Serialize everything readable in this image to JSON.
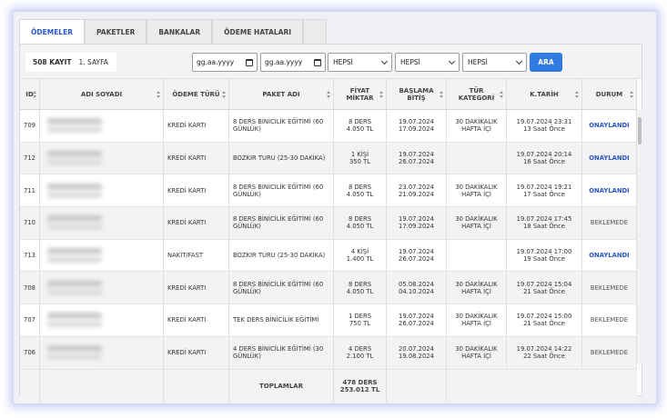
{
  "tabs": [
    {
      "label": "ÖDEMELER",
      "active": true
    },
    {
      "label": "PAKETLER"
    },
    {
      "label": "BANKALAR"
    },
    {
      "label": "ÖDEME HATALARI"
    }
  ],
  "toolbar": {
    "count": "508 KAYIT",
    "page": "1. SAYFA",
    "date1": "gg.aa.yyyy",
    "date2": "gg.aa.yyyy",
    "select1": "HEPSİ",
    "select2": "HEPSİ",
    "select3": "HEPSİ",
    "search_button": "ARA"
  },
  "columns": {
    "id": "ID",
    "name": "ADI SOYADI",
    "type": "ÖDEME TÜRÜ",
    "package": "PAKET ADI",
    "fee1": "FİYAT",
    "fee2": "MİKTAR",
    "date1": "BAŞLAMA",
    "date2": "BİTİŞ",
    "cat1": "TÜR",
    "cat2": "KATEGORİ",
    "ktarih": "K.TARİH",
    "status": "DURUM"
  },
  "rows": [
    {
      "id": "709",
      "type": "KREDİ KARTI",
      "package": "8 DERS BİNİCİLİK EĞİTİMİ (60 GÜNLÜK)",
      "qty": "8 DERS",
      "price": "4.050 TL",
      "start": "19.07.2024",
      "end": "17.09.2024",
      "cat1": "30 DAKİKALIK",
      "cat2": "HAFTA İÇİ",
      "kdate": "19.07.2024 23:31",
      "kago": "13 Saat Önce",
      "status": "ONAYLANDI",
      "ok": true
    },
    {
      "id": "712",
      "type": "KREDİ KARTI",
      "package": "BOZKIR TURU (25-30 DAKİKA)",
      "qty": "1 KİŞİ",
      "price": "350 TL",
      "start": "19.07.2024",
      "end": "26.07.2024",
      "cat1": "",
      "cat2": "",
      "kdate": "19.07.2024 20:14",
      "kago": "16 Saat Önce",
      "status": "ONAYLANDI",
      "ok": true
    },
    {
      "id": "711",
      "type": "KREDİ KARTI",
      "package": "8 DERS BİNİCİLİK EĞİTİMİ (60 GÜNLÜK)",
      "qty": "8 DERS",
      "price": "4.050 TL",
      "start": "23.07.2024",
      "end": "21.09.2024",
      "cat1": "30 DAKİKALIK",
      "cat2": "HAFTA İÇİ",
      "kdate": "19.07.2024 19:21",
      "kago": "17 Saat Önce",
      "status": "ONAYLANDI",
      "ok": true
    },
    {
      "id": "710",
      "type": "KREDİ KARTI",
      "package": "8 DERS BİNİCİLİK EĞİTİMİ (60 GÜNLÜK)",
      "qty": "8 DERS",
      "price": "4.050 TL",
      "start": "19.07.2024",
      "end": "17.09.2024",
      "cat1": "30 DAKİKALIK",
      "cat2": "HAFTA İÇİ",
      "kdate": "19.07.2024 17:45",
      "kago": "18 Saat Önce",
      "status": "BEKLEMEDE",
      "ok": false
    },
    {
      "id": "713",
      "type": "NAKİT/FAST",
      "package": "BOZKIR TURU (25-30 DAKİKA)",
      "qty": "4 KİŞİ",
      "price": "1.400 TL",
      "start": "19.07.2024",
      "end": "26.07.2024",
      "cat1": "",
      "cat2": "",
      "kdate": "19.07.2024 17:00",
      "kago": "19 Saat Önce",
      "status": "ONAYLANDI",
      "ok": true
    },
    {
      "id": "708",
      "type": "KREDİ KARTI",
      "package": "8 DERS BİNİCİLİK EĞİTİMİ (60 GÜNLÜK)",
      "qty": "8 DERS",
      "price": "4.050 TL",
      "start": "05.08.2024",
      "end": "04.10.2024",
      "cat1": "30 DAKİKALIK",
      "cat2": "HAFTA İÇİ",
      "kdate": "19.07.2024 15:04",
      "kago": "21 Saat Önce",
      "status": "BEKLEMEDE",
      "ok": false
    },
    {
      "id": "707",
      "type": "KREDİ KARTI",
      "package": "TEK DERS BİNİCİLİK EĞİTİMİ",
      "qty": "1 DERS",
      "price": "750 TL",
      "start": "19.07.2024",
      "end": "26.07.2024",
      "cat1": "30 DAKİKALIK",
      "cat2": "HAFTA İÇİ",
      "kdate": "19.07.2024 15:00",
      "kago": "21 Saat Önce",
      "status": "BEKLEMEDE",
      "ok": false
    },
    {
      "id": "706",
      "type": "KREDİ KARTI",
      "package": "4 DERS BİNİCİLİK EĞİTİMİ (30 GÜNLÜK)",
      "qty": "4 DERS",
      "price": "2.100 TL",
      "start": "20.07.2024",
      "end": "19.08.2024",
      "cat1": "30 DAKİKALIK",
      "cat2": "HAFTA İÇİ",
      "kdate": "19.07.2024 14:22",
      "kago": "22 Saat Önce",
      "status": "BEKLEMEDE",
      "ok": false
    }
  ],
  "footer": {
    "label": "TOPLAMLAR",
    "total_qty": "478 DERS",
    "total_price": "253.012 TL"
  },
  "colors": {
    "accent": "#2a56c8",
    "button": "#2f7be0"
  }
}
